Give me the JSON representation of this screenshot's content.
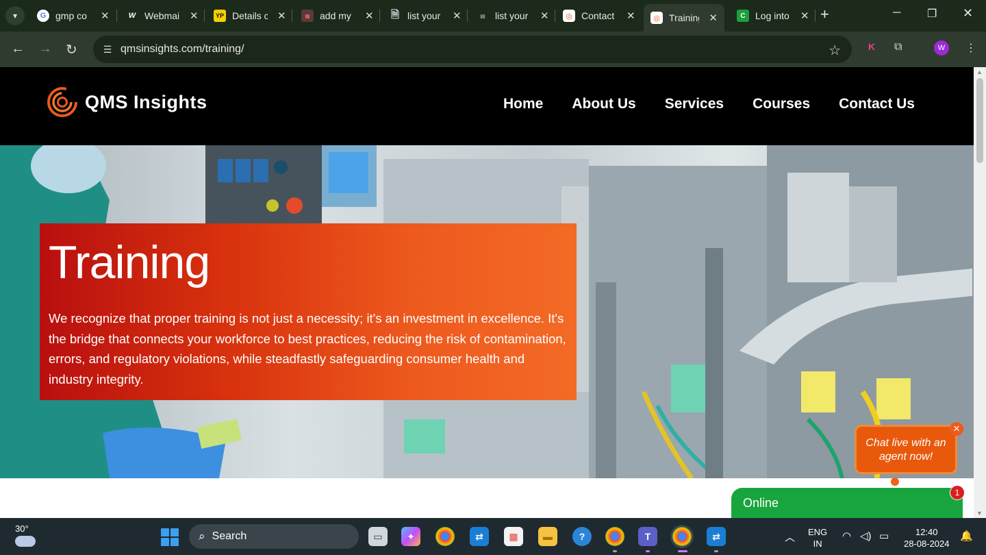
{
  "browser": {
    "tabs": [
      {
        "title": "gmp co",
        "icon": "google-icon",
        "active": false
      },
      {
        "title": "Webmai",
        "icon": "webmail-icon",
        "active": false
      },
      {
        "title": "Details c",
        "icon": "yellow-pages-icon",
        "active": false
      },
      {
        "title": "add my",
        "icon": "directory-icon",
        "active": false
      },
      {
        "title": "list your",
        "icon": "document-icon",
        "active": false
      },
      {
        "title": "list your",
        "icon": "smart-icon",
        "active": false
      },
      {
        "title": "Contact",
        "icon": "qms-icon",
        "active": false
      },
      {
        "title": "Training",
        "icon": "qms-icon",
        "active": true
      },
      {
        "title": "Log into",
        "icon": "cs-icon",
        "active": false
      }
    ],
    "url": "qmsinsights.com/training/",
    "profile_initial": "W",
    "extension_initial": "K"
  },
  "site": {
    "brand": "QMS Insights",
    "nav": [
      "Home",
      "About Us",
      "Services",
      "Courses",
      "Contact Us"
    ],
    "accent": "#e85a1a"
  },
  "hero": {
    "title": "Training",
    "text": "We recognize that proper training is not just a necessity; it's an investment in excellence. It's the bridge that connects your workforce to best practices, reducing the risk of contamination, errors, and regulatory violations, while steadfastly safeguarding consumer health and industry integrity."
  },
  "chat": {
    "bubble_text": "Chat live with an agent now!",
    "close_label": "✕",
    "status": "Online",
    "badge_count": "1"
  },
  "taskbar": {
    "temperature": "30°",
    "search_label": "Search",
    "language": "ENG",
    "region": "IN",
    "time": "12:40",
    "date": "28-08-2024"
  }
}
